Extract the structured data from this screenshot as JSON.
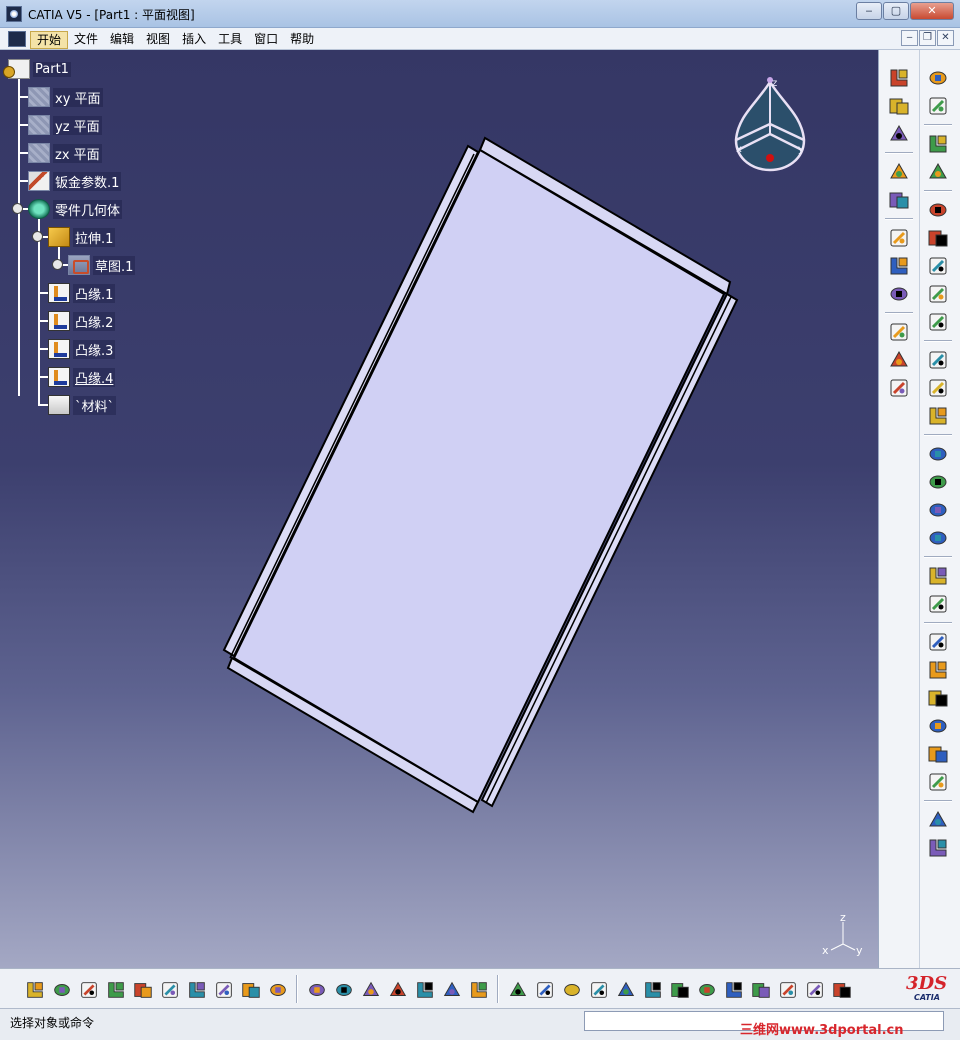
{
  "window": {
    "title": "CATIA V5 - [Part1 : 平面视图]",
    "controls": {
      "minimize": "‒",
      "maximize": "▢",
      "close": "✕"
    }
  },
  "menubar": {
    "items": [
      "开始",
      "文件",
      "编辑",
      "视图",
      "插入",
      "工具",
      "窗口",
      "帮助"
    ],
    "active_index": 0,
    "doc_controls": {
      "minimize": "‒",
      "restore": "❐",
      "close": "✕"
    }
  },
  "tree": {
    "nodes": [
      {
        "label": "Part1",
        "icon": "part-icon",
        "underline": false
      },
      {
        "label": "xy 平面",
        "icon": "plane-icon",
        "underline": false
      },
      {
        "label": "yz 平面",
        "icon": "plane-icon",
        "underline": false
      },
      {
        "label": "zx 平面",
        "icon": "plane-icon",
        "underline": false
      },
      {
        "label": "钣金参数.1",
        "icon": "sheetmetal-params-icon",
        "underline": false
      },
      {
        "label": "零件几何体",
        "icon": "part-body-icon",
        "underline": false
      },
      {
        "label": "拉伸.1",
        "icon": "extrude-icon",
        "underline": false
      },
      {
        "label": "草图.1",
        "icon": "sketch-icon",
        "underline": false
      },
      {
        "label": "凸缘.1",
        "icon": "flange-icon",
        "underline": false
      },
      {
        "label": "凸缘.2",
        "icon": "flange-icon",
        "underline": false
      },
      {
        "label": "凸缘.3",
        "icon": "flange-icon",
        "underline": false
      },
      {
        "label": "凸缘.4",
        "icon": "flange-icon",
        "underline": true
      },
      {
        "label": "`材料`",
        "icon": "material-icon",
        "underline": false
      }
    ]
  },
  "compass": {
    "labels": {
      "z": "z",
      "x": "x",
      "y": "y"
    },
    "icon": "compass-icon"
  },
  "mini_axis": {
    "labels": {
      "z": "z",
      "x": "x",
      "y": "y"
    }
  },
  "right_toolbar": {
    "col1": [
      "sheetmetal-params-tool-icon",
      "recognize-icon",
      "walls-icon",
      "separator",
      "wall-icon",
      "unfold-view-icon",
      "separator",
      "dimension-icon",
      "arrow-icon",
      "sketch-tool-icon",
      "separator",
      "point-icon",
      "line-icon",
      "plane-tool-icon"
    ],
    "col2": [
      "sketcher-icon",
      "select-arrow-icon",
      "separator",
      "sketch-plane-icon",
      "cancel-icon",
      "separator",
      "wall-edge-icon",
      "extrude-tool-icon",
      "flange-tool-icon",
      "hem-icon",
      "tear-drop-icon",
      "separator",
      "bend-icon",
      "flat-bend-icon",
      "unfold-icon",
      "separator",
      "corner-icon",
      "chamfer-icon",
      "folding-icon",
      "cut-out-icon",
      "separator",
      "transform-icon",
      "mirror-icon",
      "separator",
      "hole-icon",
      "circular-cutout-icon",
      "stamp-icon",
      "bead-icon",
      "louver-icon",
      "emboss-icon",
      "separator",
      "view-icon",
      "save-dxf-icon"
    ]
  },
  "bottom_toolbar": {
    "icons": [
      "new-icon",
      "open-icon",
      "save-icon",
      "print-icon",
      "cut-icon",
      "copy-icon",
      "paste-icon",
      "undo-icon",
      "redo-icon",
      "whats-this-icon",
      "separator",
      "formula-icon",
      "comment-icon",
      "knowledge-icon",
      "table-icon",
      "tree-icon",
      "lock-icon",
      "parameters-icon",
      "separator",
      "fly-icon",
      "fit-all-icon",
      "pan-icon",
      "rotate-icon",
      "zoom-in-icon",
      "zoom-out-icon",
      "normal-view-icon",
      "multi-view-icon",
      "iso-view-icon",
      "hide-show-icon",
      "swap-icon",
      "render-icon",
      "shading-icon"
    ],
    "logo": {
      "ds": "3DS",
      "name": "CATIA"
    }
  },
  "statusbar": {
    "prompt": "选择对象或命令",
    "command_value": "",
    "watermark": "三维网www.3dportal.cn"
  },
  "colors": {
    "viewport_top": "#353765",
    "viewport_bottom": "#a4a8c4",
    "part_fill": "#d0d0f4",
    "part_edge": "#000000",
    "flange_fill": "#d6d6f2"
  }
}
